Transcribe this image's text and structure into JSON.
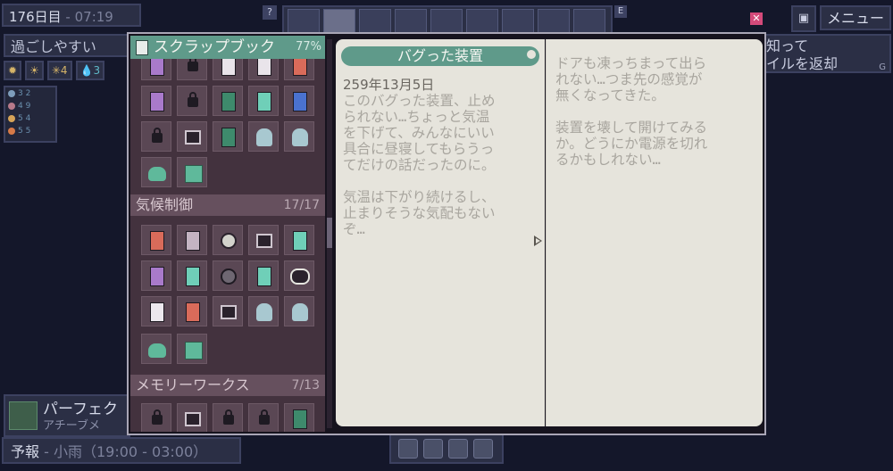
{
  "hud": {
    "day": "176日目",
    "time": "07:19",
    "mood": "過ごしやすい",
    "help": "?",
    "e_key": "E",
    "menu": "メニュー",
    "quest_line1": "知って",
    "quest_line2": "イルを返却",
    "quest_key": "G",
    "stats": [
      "4",
      "3"
    ],
    "perfect_title": "パーフェク",
    "perfect_sub": "アチーブメ",
    "forecast_label": "予報",
    "forecast_value": "小雨（19:00 - 03:00）"
  },
  "resources": [
    "3",
    "4",
    "5",
    "5",
    "2",
    "9",
    "4",
    "5"
  ],
  "sidebar": {
    "title": "スクラップブック",
    "progress": "77%",
    "categories": [
      {
        "name": "気候制御",
        "count": "17/17"
      },
      {
        "name": "メモリーワークス",
        "count": "7/13"
      }
    ]
  },
  "entry": {
    "title": "バグった装置",
    "date": "259年13月5日",
    "left_text": "このバグった装置、止め\nられない…ちょっと気温\nを下げて、みんなにいい\n具合に昼寝してもらうっ\nてだけの話だったのに。\n\n気温は下がり続けるし、\n止まりそうな気配もない\nぞ…",
    "right_text": "ドアも凍っちまって出ら\nれない…つま先の感覚が\n無くなってきた。\n\n装置を壊して開けてみる\nか。どうにか電源を切れ\nるかもしれない…"
  },
  "colors": {
    "accent": "#5f9a8a",
    "page": "#e6e4dc",
    "sidebar": "#43323e"
  }
}
